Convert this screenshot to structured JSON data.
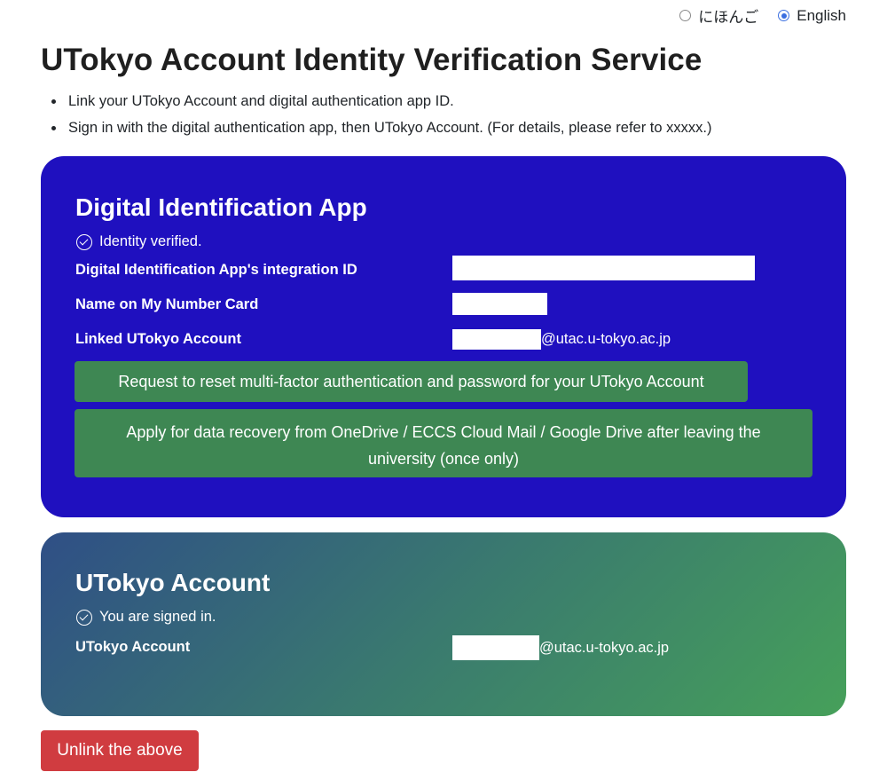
{
  "language": {
    "options": [
      {
        "label": "にほんご",
        "selected": false
      },
      {
        "label": "English",
        "selected": true
      }
    ]
  },
  "page": {
    "title": "UTokyo Account Identity Verification Service",
    "intro": [
      "Link your UTokyo Account and digital authentication app ID.",
      "Sign in with the digital authentication app, then UTokyo Account. (For details, please refer to xxxxx.)"
    ]
  },
  "app_card": {
    "title": "Digital Identification App",
    "status": "Identity verified.",
    "fields": {
      "integration_id_label": "Digital Identification App's integration ID",
      "name_label": "Name on My Number Card",
      "linked_account_label": "Linked UTokyo Account",
      "linked_account_domain": "@utac.u-tokyo.ac.jp"
    },
    "buttons": {
      "reset_mfa": "Request to reset multi-factor authentication and password for your UTokyo Account",
      "data_recovery": "Apply for data recovery from OneDrive / ECCS Cloud Mail / Google Drive after leaving the university (once only)"
    },
    "color": "#1f10bf"
  },
  "account_card": {
    "title": "UTokyo Account",
    "status": "You are signed in.",
    "account_label": "UTokyo Account",
    "account_domain": "@utac.u-tokyo.ac.jp"
  },
  "unlink_button": "Unlink the above",
  "colors": {
    "primary_button": "#3e8753",
    "danger_button": "#d03c40",
    "radio_accent": "#3b6fe0"
  }
}
